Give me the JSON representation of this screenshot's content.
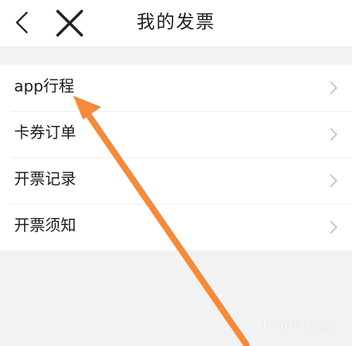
{
  "header": {
    "title": "我的发票",
    "back_icon": "chevron-left-icon",
    "close_icon": "close-x-icon"
  },
  "menu": {
    "items": [
      {
        "label": "app行程",
        "icon": "chevron-right-icon"
      },
      {
        "label": "卡券订单",
        "icon": "chevron-right-icon"
      },
      {
        "label": "开票记录",
        "icon": "chevron-right-icon"
      },
      {
        "label": "开票须知",
        "icon": "chevron-right-icon"
      }
    ]
  },
  "annotation": {
    "arrow_color": "#F58A3A"
  },
  "watermark": {
    "text": "Baidu 经验"
  },
  "colors": {
    "background": "#f2f2f2",
    "surface": "#ffffff",
    "text": "#1e1e1e",
    "chevron": "#c4c4c4"
  }
}
